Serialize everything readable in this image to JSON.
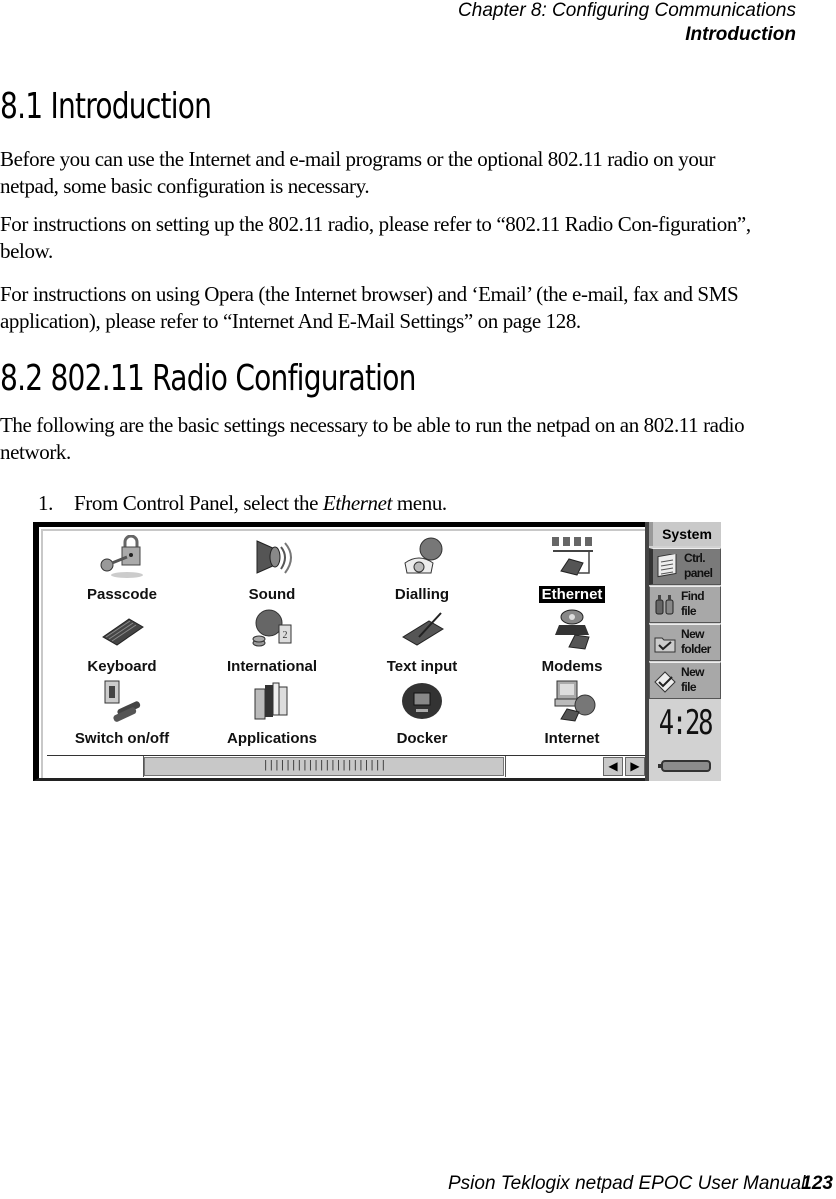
{
  "running_head": {
    "chapter": "Chapter 8:  Configuring Communications",
    "section": "Introduction"
  },
  "sections": [
    {
      "heading": "8.1  Introduction",
      "paragraphs": [
        "Before you can use the Internet and e-mail programs or the optional 802.11 radio on your netpad, some basic configuration is necessary.",
        "For instructions on setting up the 802.11 radio, please refer to “802.11 Radio Con-figuration”, below.",
        "For instructions on using Opera (the Internet browser) and ‘Email’ (the e-mail, fax and SMS application), please refer to “Internet And E-Mail Settings” on page 128."
      ]
    },
    {
      "heading": "8.2  802.11 Radio Configuration",
      "paragraphs": [
        "The following are the basic settings necessary to be able to run the netpad on an 802.11 radio network."
      ]
    }
  ],
  "steps": [
    {
      "number": "1.",
      "text_before": "From Control Panel, select the ",
      "emphasis": "Ethernet",
      "text_after": " menu."
    }
  ],
  "screenshot": {
    "control_panel_items": [
      {
        "label": "Passcode",
        "icon": "padlock-key-icon",
        "selected": false
      },
      {
        "label": "Sound",
        "icon": "speaker-icon",
        "selected": false
      },
      {
        "label": "Dialling",
        "icon": "telephone-globe-icon",
        "selected": false
      },
      {
        "label": "Ethernet",
        "icon": "network-icon",
        "selected": true
      },
      {
        "label": "Keyboard",
        "icon": "keyboard-icon",
        "selected": false
      },
      {
        "label": "International",
        "icon": "globe-coins-icon",
        "selected": false
      },
      {
        "label": "Text input",
        "icon": "pen-keyboard-icon",
        "selected": false
      },
      {
        "label": "Modems",
        "icon": "modem-icon",
        "selected": false
      },
      {
        "label": "Switch on/off",
        "icon": "switch-batteries-icon",
        "selected": false
      },
      {
        "label": "Applications",
        "icon": "books-icon",
        "selected": false
      },
      {
        "label": "Docker",
        "icon": "docker-icon",
        "selected": false
      },
      {
        "label": "Internet",
        "icon": "computer-globe-icon",
        "selected": false
      }
    ],
    "scrollbar": {
      "thumb_grip": "||||||||||||||||||||||",
      "prev_glyph": "◀",
      "next_glyph": "▶"
    },
    "sidebar": {
      "title": "System",
      "buttons": [
        {
          "label": "Ctrl. panel",
          "icon": "ctrl-panel-icon",
          "active": true
        },
        {
          "label": "Find file",
          "icon": "binoculars-icon",
          "active": false
        },
        {
          "label": "New folder",
          "icon": "folder-check-icon",
          "active": false
        },
        {
          "label": "New file",
          "icon": "file-check-icon",
          "active": false
        }
      ],
      "clock": "4:28"
    }
  },
  "footer": {
    "manual_title": "Psion Teklogix netpad EPOC User Manual",
    "page_number": "123"
  }
}
